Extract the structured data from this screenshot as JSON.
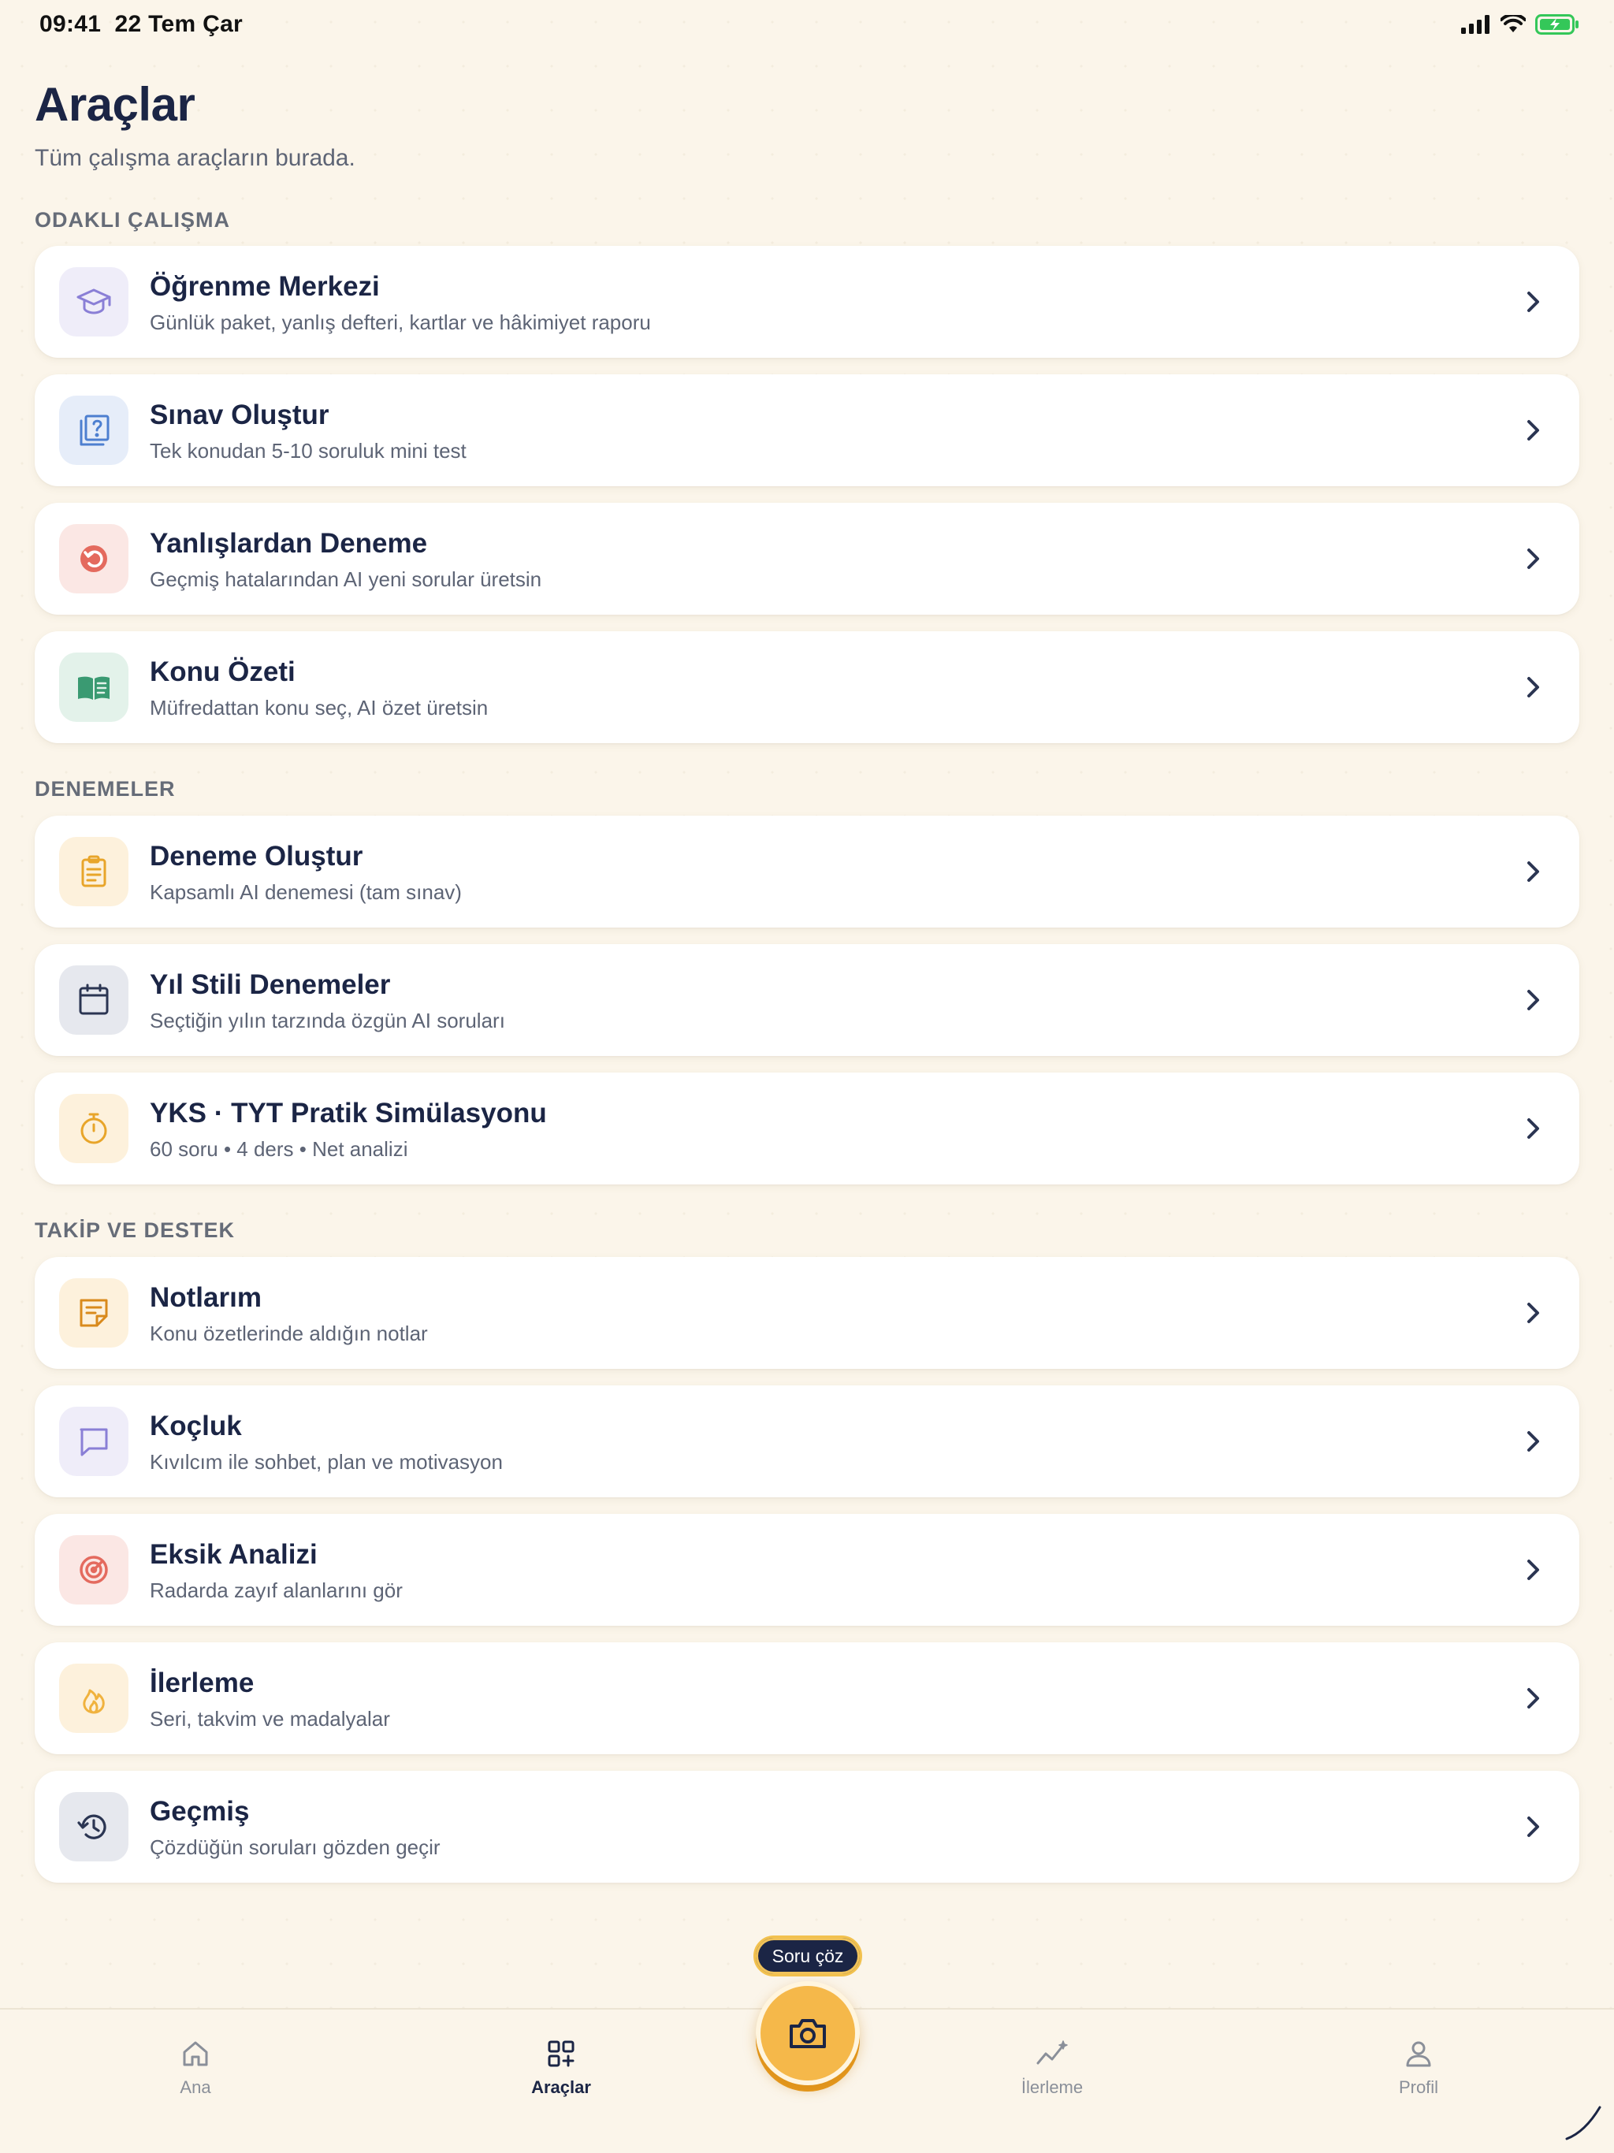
{
  "status": {
    "time": "09:41",
    "date": "22 Tem Çar"
  },
  "header": {
    "title": "Araçlar",
    "subtitle": "Tüm çalışma araçların burada."
  },
  "sections": {
    "focused": {
      "label": "ODAKLI ÇALIŞMA",
      "items": [
        {
          "title": "Öğrenme Merkezi",
          "desc": "Günlük paket, yanlış defteri, kartlar ve hâkimiyet raporu",
          "icon": "graduation-cap-icon",
          "color": "#8a7fd6",
          "bg": "#efedf9"
        },
        {
          "title": "Sınav Oluştur",
          "desc": "Tek konudan 5-10 soruluk mini test",
          "icon": "question-book-icon",
          "color": "#4d7fd0",
          "bg": "#e6edf9"
        },
        {
          "title": "Yanlışlardan Deneme",
          "desc": "Geçmiş hatalarından AI yeni sorular üretsin",
          "icon": "retry-icon",
          "color": "#e46a5e",
          "bg": "#fbe7e4"
        },
        {
          "title": "Konu Özeti",
          "desc": "Müfredattan konu seç, AI özet üretsin",
          "icon": "open-book-icon",
          "color": "#3a9a72",
          "bg": "#e3f2ea"
        }
      ]
    },
    "exams": {
      "label": "DENEMELER",
      "items": [
        {
          "title": "Deneme Oluştur",
          "desc": "Kapsamlı AI denemesi (tam sınav)",
          "icon": "clipboard-icon",
          "color": "#e8a52a",
          "bg": "#fdf1dc"
        },
        {
          "title": "Yıl Stili Denemeler",
          "desc": "Seçtiğin yılın tarzında özgün AI soruları",
          "icon": "calendar-icon",
          "color": "#2b3552",
          "bg": "#e6e8ee"
        },
        {
          "title": "YKS · TYT Pratik Simülasyonu",
          "desc": "60 soru • 4 ders • Net analizi",
          "icon": "stopwatch-icon",
          "color": "#e8a52a",
          "bg": "#fdf1dc"
        }
      ]
    },
    "support": {
      "label": "TAKİP VE DESTEK",
      "items": [
        {
          "title": "Notlarım",
          "desc": "Konu özetlerinde aldığın notlar",
          "icon": "note-icon",
          "color": "#d98a1c",
          "bg": "#fdf1dc"
        },
        {
          "title": "Koçluk",
          "desc": "Kıvılcım ile sohbet, plan ve motivasyon",
          "icon": "chat-bubble-icon",
          "color": "#8a7fd6",
          "bg": "#efedf9"
        },
        {
          "title": "Eksik Analizi",
          "desc": "Radarda zayıf alanlarını gör",
          "icon": "target-icon",
          "color": "#e46a5e",
          "bg": "#fbe7e4"
        },
        {
          "title": "İlerleme",
          "desc": "Seri, takvim ve madalyalar",
          "icon": "flame-icon",
          "color": "#f0b23e",
          "bg": "#fdf1dc"
        },
        {
          "title": "Geçmiş",
          "desc": "Çözdüğün soruları gözden geçir",
          "icon": "history-icon",
          "color": "#2b3552",
          "bg": "#e6e8ee"
        }
      ]
    }
  },
  "fab": {
    "tooltip": "Soru çöz",
    "icon": "camera-icon"
  },
  "nav": {
    "home": "Ana",
    "tools": "Araçlar",
    "progress": "İlerleme",
    "profile": "Profil",
    "active": "tools"
  }
}
